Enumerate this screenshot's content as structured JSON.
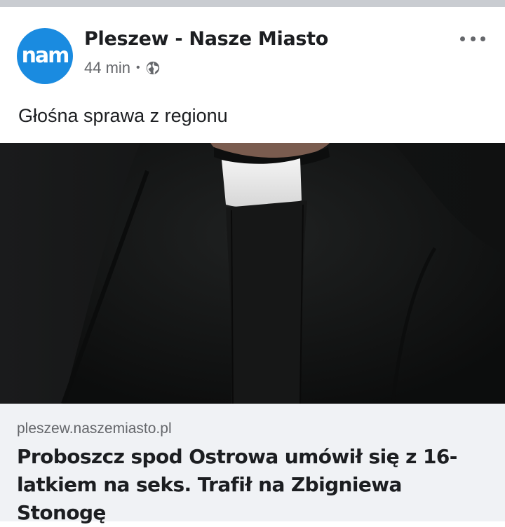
{
  "post": {
    "page_name": "Pleszew - Nasze Miasto",
    "avatar_text": "nam",
    "time": "44 min",
    "separator": "•",
    "audience_icon": "globe-icon",
    "more_icon": "more-options-icon",
    "caption": "Głośna sprawa z regionu",
    "photo_icon": "priest-collar-photo",
    "link": {
      "domain": "pleszew.naszemiasto.pl",
      "title": "Proboszcz spod Ostrowa umówił się z 16-latkiem na seks. Trafił na Zbigniewa Stonogę"
    }
  },
  "colors": {
    "brand": "#1a8be0",
    "text_primary": "#1c1e21",
    "text_secondary": "#65676b",
    "link_background": "#f0f2f5"
  }
}
